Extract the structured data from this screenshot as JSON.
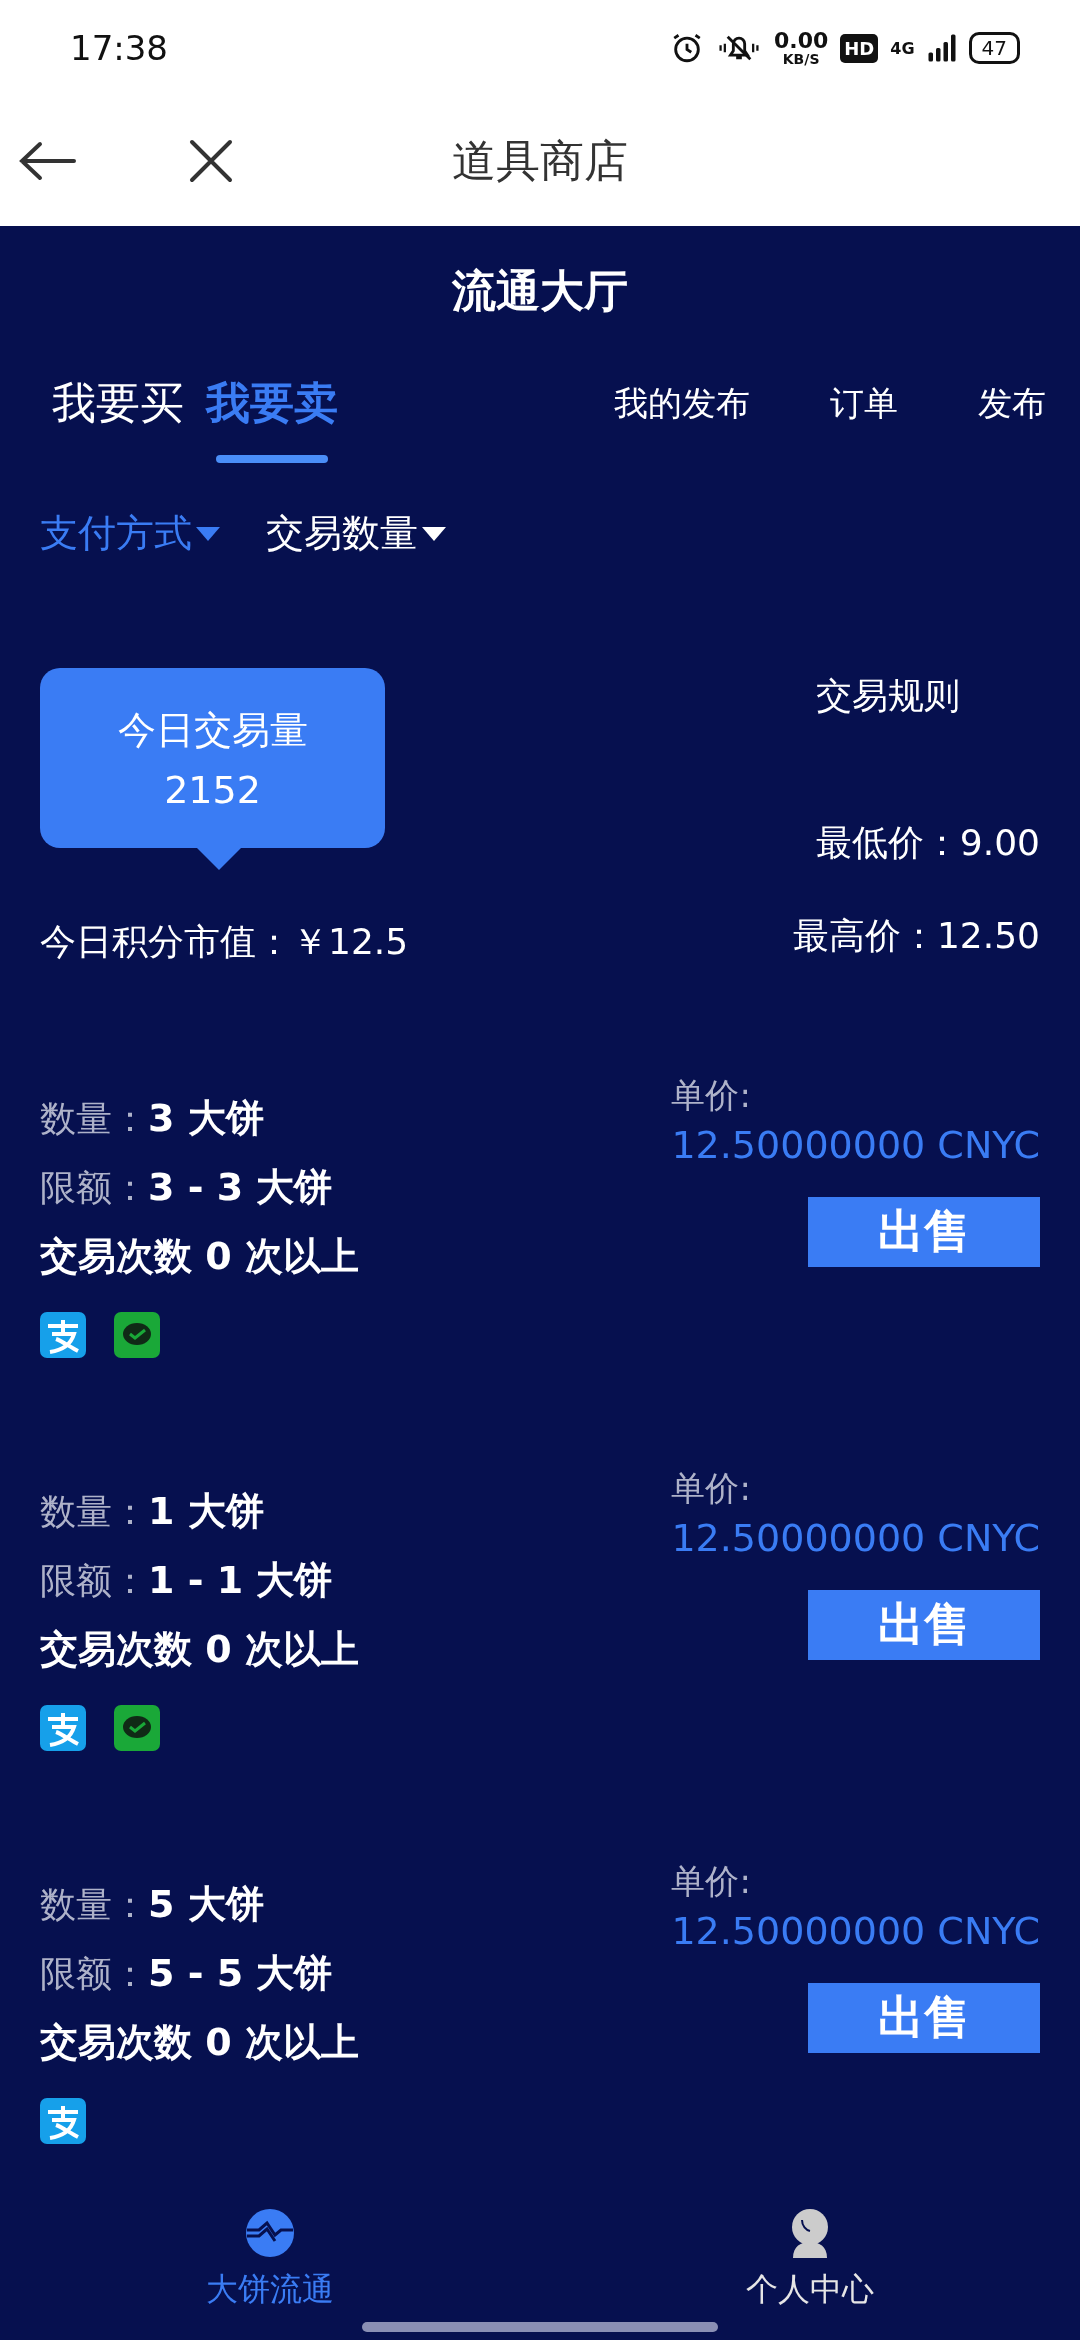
{
  "status_bar": {
    "time": "17:38",
    "speed_value": "0.00",
    "speed_unit": "KB/S",
    "hd": "HD",
    "network": "4G",
    "battery": "47"
  },
  "nav": {
    "title": "道具商店"
  },
  "hall": {
    "title": "流通大厅"
  },
  "tabs": [
    {
      "label": "我要买",
      "selected": false
    },
    {
      "label": "我要卖",
      "selected": true
    }
  ],
  "links": [
    "我的发布",
    "订单",
    "发布"
  ],
  "filters": [
    {
      "label": "支付方式",
      "selected": true
    },
    {
      "label": "交易数量",
      "selected": false
    }
  ],
  "stats": {
    "volume_label": "今日交易量",
    "volume": "2152",
    "rules": "交易规则",
    "min_price": "最低价：9.00",
    "market_value": "今日积分市值：￥12.5",
    "max_price": "最高价：12.50"
  },
  "listings": [
    {
      "quantity_label": "数量：",
      "quantity": "3 大饼",
      "limit_label": "限额：",
      "limit": "3 - 3 大饼",
      "trades": "交易次数 0 次以上",
      "price_label": "单价:",
      "price": "12.50000000 CNYC",
      "action": "出售",
      "payments": [
        {
          "kind": "alipay"
        },
        {
          "kind": "wechat"
        }
      ]
    },
    {
      "quantity_label": "数量：",
      "quantity": "1 大饼",
      "limit_label": "限额：",
      "limit": "1 - 1 大饼",
      "trades": "交易次数 0 次以上",
      "price_label": "单价:",
      "price": "12.50000000 CNYC",
      "action": "出售",
      "payments": [
        {
          "kind": "alipay"
        },
        {
          "kind": "wechat"
        }
      ]
    },
    {
      "quantity_label": "数量：",
      "quantity": "5 大饼",
      "limit_label": "限额：",
      "limit": "5 - 5 大饼",
      "trades": "交易次数 0 次以上",
      "price_label": "单价:",
      "price": "12.50000000 CNYC",
      "action": "出售",
      "payments": [
        {
          "kind": "alipay"
        }
      ]
    }
  ],
  "bottom_nav": [
    {
      "label": "大饼流通",
      "kind": "market",
      "selected": true
    },
    {
      "label": "个人中心",
      "kind": "profile",
      "selected": false
    }
  ]
}
